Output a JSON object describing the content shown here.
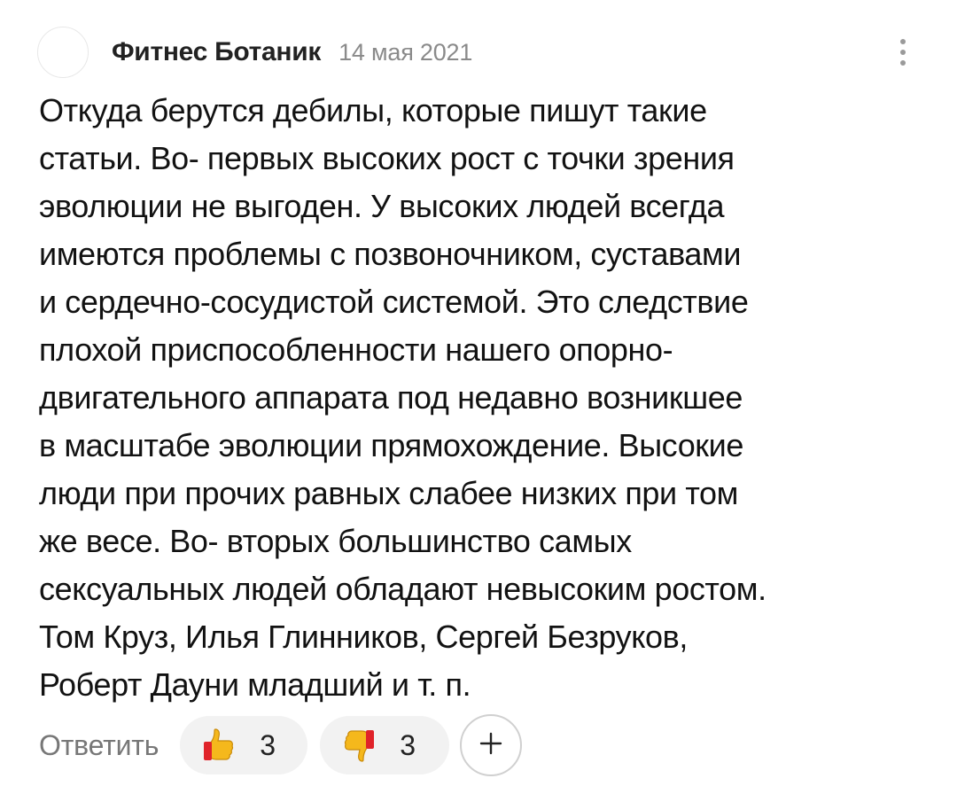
{
  "comment": {
    "author": "Фитнес Ботаник",
    "date": "14 мая 2021",
    "text": "Откуда берутся дебилы, которые пишут такие\nстатьи. Во- первых высоких рост с точки зрения\nэволюции не выгоден. У высоких людей всегда\nимеются проблемы с позвоночником, суставами\nи сердечно-сосудистой системой. Это следствие\nплохой приспособленности нашего опорно-\nдвигательного аппарата под недавно возникшее\nв масштабе эволюции прямохождение. Высокие\nлюди при прочих равных слабее низких при том\nже весе. Во- вторых большинство самых\nсексуальных людей обладают невысоким ростом.\nТом Круз, Илья Глинников, Сергей Безруков,\nРоберт Дауни младший и т. п."
  },
  "actions": {
    "reply_label": "Ответить",
    "like_count": "3",
    "dislike_count": "3"
  },
  "icons": {
    "menu": "more-vertical-icon",
    "like": "thumbs-up-icon",
    "dislike": "thumbs-down-icon",
    "add": "plus-icon"
  },
  "colors": {
    "author": "#222222",
    "date": "#8a8a8a",
    "text": "#121212",
    "reply": "#777777",
    "pill_background": "#f2f2f2",
    "thumb_fill": "#f5b81c",
    "thumb_cuff": "#e0232a"
  }
}
